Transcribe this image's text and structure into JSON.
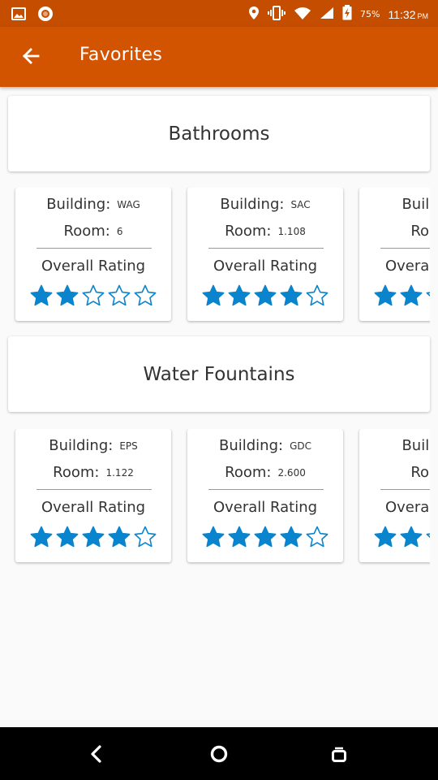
{
  "status_bar": {
    "battery": "75%",
    "time": "11:32",
    "ampm": "PM",
    "icons": [
      "gallery-icon",
      "record-icon",
      "location-icon",
      "vibrate-icon",
      "wifi-icon",
      "signal-icon",
      "battery-charging-icon"
    ]
  },
  "app_bar": {
    "title": "Favorites",
    "back_icon": "arrow-back-icon"
  },
  "labels": {
    "building": "Building:",
    "room": "Room:",
    "rating": "Overall Rating"
  },
  "sections": [
    {
      "title": "Bathrooms",
      "cards": [
        {
          "building": "WAG",
          "room": "6",
          "rating": 2
        },
        {
          "building": "SAC",
          "room": "1.108",
          "rating": 4
        },
        {
          "building": "",
          "room": "",
          "rating": 2
        }
      ]
    },
    {
      "title": "Water Fountains",
      "cards": [
        {
          "building": "EPS",
          "room": "1.122",
          "rating": 4
        },
        {
          "building": "GDC",
          "room": "2.600",
          "rating": 4
        },
        {
          "building": "",
          "room": "",
          "rating": 2
        }
      ]
    }
  ],
  "colors": {
    "status_bar": "#c44d00",
    "app_bar": "#d35400",
    "star": "#0a84cc",
    "background": "#fafafa"
  },
  "nav_bar": {
    "icons": [
      "back-triangle-icon",
      "home-circle-icon",
      "recents-square-icon"
    ]
  }
}
